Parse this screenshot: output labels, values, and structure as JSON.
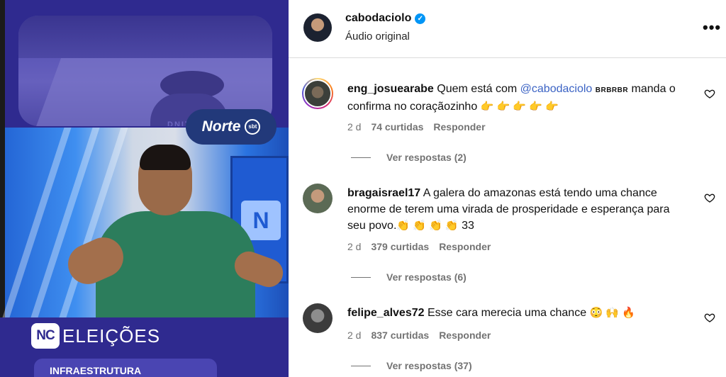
{
  "video": {
    "aerial_sign": "DNIT",
    "brand": {
      "name": "Norte",
      "network": "sbt"
    },
    "studio_screen_letter": "N",
    "footer": {
      "logo": "NC",
      "title": "ELEIÇÕES",
      "tag": "INFRAESTRUTURA"
    }
  },
  "header": {
    "username": "cabodaciolo",
    "verified_mark": "✓",
    "audio": "Áudio original",
    "more_glyph": "•••"
  },
  "comments": [
    {
      "username": "eng_josuearabe",
      "text_before": "Quem está com ",
      "mention": "@cabodaciolo",
      "small_text": "BRBRBR",
      "text_after": " manda o confirma no coraçãozinho",
      "emojis": "👉 👉 👉 👉 👉",
      "age": "2 d",
      "likes": "74 curtidas",
      "reply": "Responder",
      "view_replies": "Ver respostas (2)"
    },
    {
      "username": "bragaisrael17",
      "text": "A galera do amazonas está tendo uma chance enorme de terem uma virada de prosperidade e esperança para seu povo.",
      "emojis": "👏 👏 👏 👏",
      "suffix": "33",
      "age": "2 d",
      "likes": "379 curtidas",
      "reply": "Responder",
      "view_replies": "Ver respostas (6)"
    },
    {
      "username": "felipe_alves72",
      "text": "Esse cara merecia uma chance",
      "emojis": "😳 🙌 🔥",
      "age": "2 d",
      "likes": "837 curtidas",
      "reply": "Responder",
      "view_replies": "Ver respostas (37)"
    }
  ],
  "colors": {
    "accent_blue": "#0095f6",
    "mention_blue": "#3b63c4",
    "video_bg": "#2f2a8f"
  }
}
